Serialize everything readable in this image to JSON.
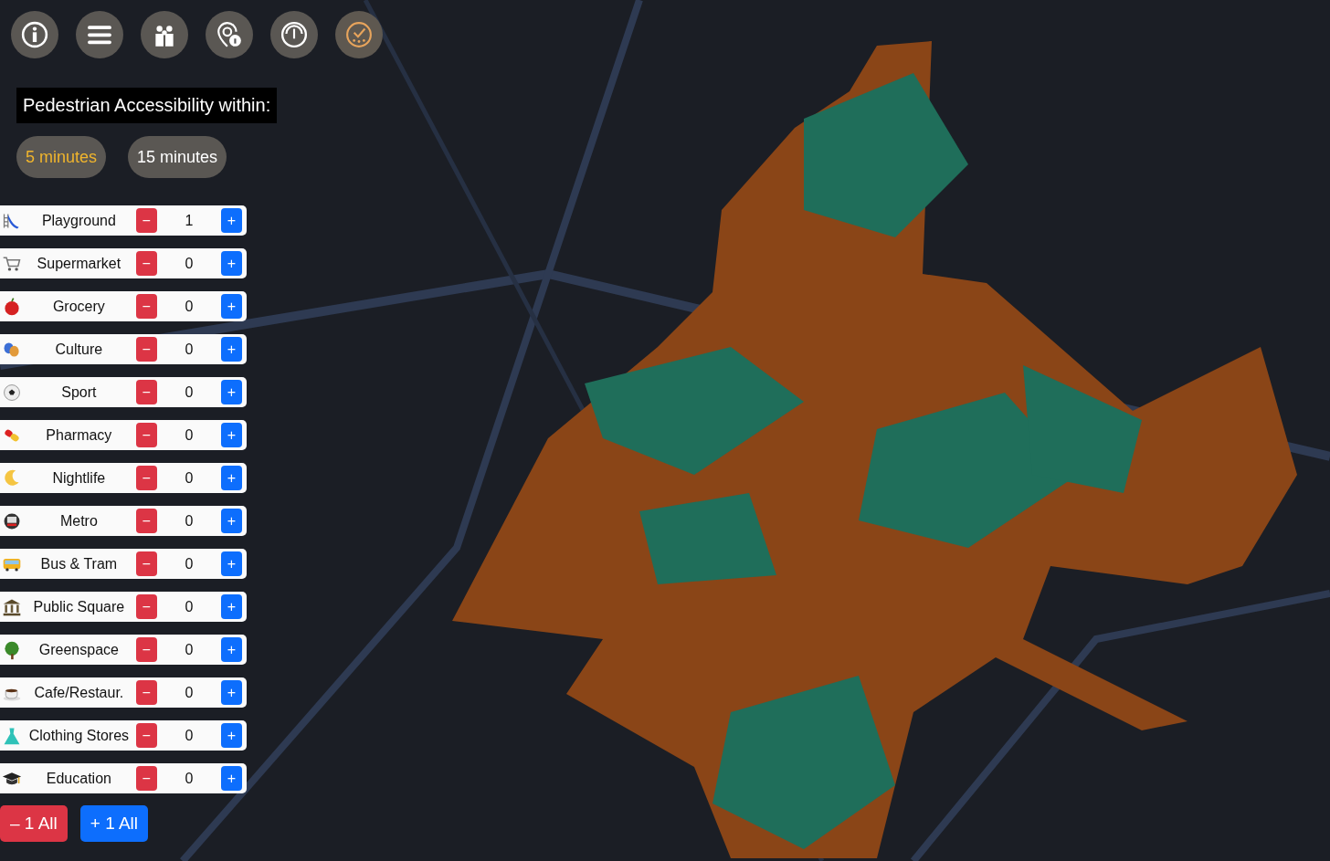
{
  "toolbar": [
    {
      "kind": "info"
    },
    {
      "kind": "menu"
    },
    {
      "kind": "people"
    },
    {
      "kind": "pin"
    },
    {
      "kind": "gauge"
    },
    {
      "kind": "check",
      "selected": true
    }
  ],
  "heading": "Pedestrian Accessibility within:",
  "time_options": [
    {
      "label": "5 minutes",
      "selected": true
    },
    {
      "label": "15 minutes",
      "selected": false
    }
  ],
  "amenities": [
    {
      "label": "Playground",
      "minus": "−",
      "count": "1",
      "plus": "+"
    },
    {
      "label": "Supermarket",
      "minus": "−",
      "count": "0",
      "plus": "+"
    },
    {
      "label": "Grocery",
      "minus": "−",
      "count": "0",
      "plus": "+"
    },
    {
      "label": "Culture",
      "minus": "−",
      "count": "0",
      "plus": "+"
    },
    {
      "label": "Sport",
      "minus": "−",
      "count": "0",
      "plus": "+"
    },
    {
      "label": "Pharmacy",
      "minus": "−",
      "count": "0",
      "plus": "+"
    },
    {
      "label": "Nightlife",
      "minus": "−",
      "count": "0",
      "plus": "+"
    },
    {
      "label": "Metro",
      "minus": "−",
      "count": "0",
      "plus": "+"
    },
    {
      "label": "Bus & Tram",
      "minus": "−",
      "count": "0",
      "plus": "+"
    },
    {
      "label": "Public Square",
      "minus": "−",
      "count": "0",
      "plus": "+"
    },
    {
      "label": "Greenspace",
      "minus": "−",
      "count": "0",
      "plus": "+"
    },
    {
      "label": "Cafe/Restaur.",
      "minus": "−",
      "count": "0",
      "plus": "+"
    },
    {
      "label": "Clothing Stores",
      "minus": "−",
      "count": "0",
      "plus": "+"
    },
    {
      "label": "Education",
      "minus": "−",
      "count": "0",
      "plus": "+"
    }
  ],
  "bulk_buttons": [
    {
      "kind": "minus",
      "label": "– 1 All"
    },
    {
      "kind": "plus",
      "label": "+ 1 All"
    }
  ]
}
